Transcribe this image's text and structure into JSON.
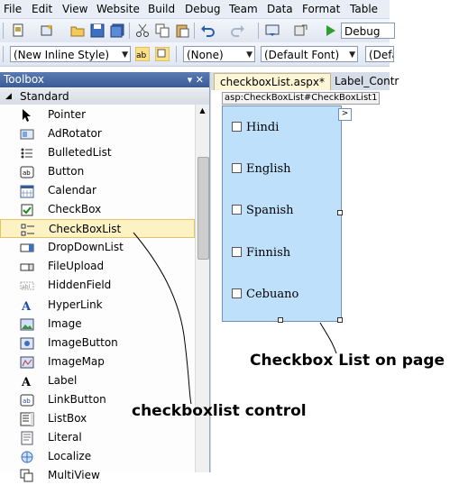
{
  "menu": [
    "File",
    "Edit",
    "View",
    "Website",
    "Build",
    "Debug",
    "Team",
    "Data",
    "Format",
    "Table"
  ],
  "toolbar": {
    "config_dropdown": "Debug"
  },
  "format_toolbar": {
    "style_dropdown": "(New Inline Style)",
    "class_dropdown": "(None)",
    "font_dropdown": "(Default Font)",
    "size_dropdown": "(Defa"
  },
  "toolbox": {
    "title": "Toolbox",
    "title_pin_glyph": "▾ ✕",
    "section": "Standard",
    "items": [
      {
        "label": "Pointer",
        "icon": "pointer-icon"
      },
      {
        "label": "AdRotator",
        "icon": "adrotator-icon"
      },
      {
        "label": "BulletedList",
        "icon": "bulletedlist-icon"
      },
      {
        "label": "Button",
        "icon": "button-icon"
      },
      {
        "label": "Calendar",
        "icon": "calendar-icon"
      },
      {
        "label": "CheckBox",
        "icon": "checkbox-icon"
      },
      {
        "label": "CheckBoxList",
        "icon": "checkboxlist-icon",
        "selected": true
      },
      {
        "label": "DropDownList",
        "icon": "dropdownlist-icon"
      },
      {
        "label": "FileUpload",
        "icon": "fileupload-icon"
      },
      {
        "label": "HiddenField",
        "icon": "hiddenfield-icon"
      },
      {
        "label": "HyperLink",
        "icon": "hyperlink-icon"
      },
      {
        "label": "Image",
        "icon": "image-icon"
      },
      {
        "label": "ImageButton",
        "icon": "imagebutton-icon"
      },
      {
        "label": "ImageMap",
        "icon": "imagemap-icon"
      },
      {
        "label": "Label",
        "icon": "label-icon"
      },
      {
        "label": "LinkButton",
        "icon": "linkbutton-icon"
      },
      {
        "label": "ListBox",
        "icon": "listbox-icon"
      },
      {
        "label": "Literal",
        "icon": "literal-icon"
      },
      {
        "label": "Localize",
        "icon": "localize-icon"
      },
      {
        "label": "MultiView",
        "icon": "multiview-icon"
      }
    ]
  },
  "designer": {
    "tabs": [
      "checkboxList.aspx*",
      "Label_Contr"
    ],
    "control_tag": "asp:CheckBoxList#CheckBoxList1",
    "smart_tag_glyph": ">",
    "options": [
      "Hindi",
      "English",
      "Spanish",
      "Finnish",
      "Cebuano"
    ]
  },
  "annotations": {
    "page_note": "Checkbox List on page",
    "control_note": "checkboxlist control"
  },
  "colors": {
    "checkboxlist_fill": "#bfe0fb",
    "selected_item": "#fdf2c4",
    "toolbox_title": "#3b5b98"
  }
}
